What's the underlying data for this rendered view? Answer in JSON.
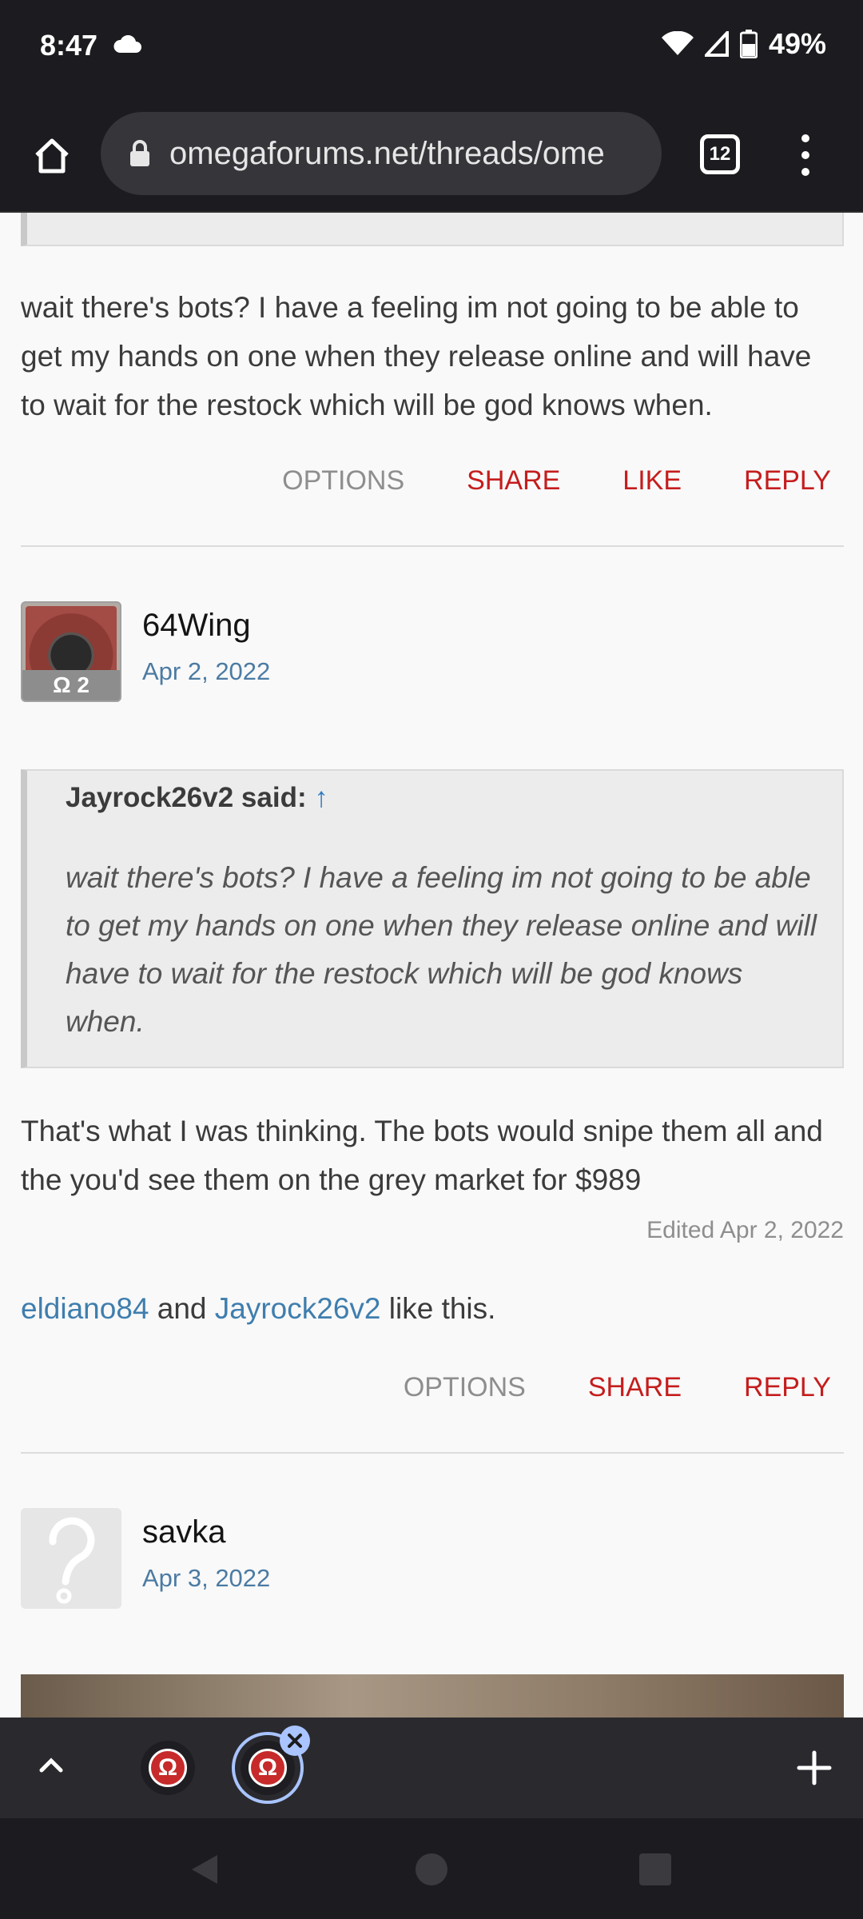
{
  "status_bar": {
    "time": "8:47",
    "battery": "49%",
    "icons": [
      "cloud-icon",
      "wifi-icon",
      "signal-icon",
      "battery-icon"
    ]
  },
  "browser": {
    "url": "omegaforums.net/threads/ome",
    "tab_count": "12"
  },
  "posts": [
    {
      "text": "wait there's bots? I have a feeling im not going to be able to get my hands on one when they release online and will have to wait for the restock which will be god knows when.",
      "actions": {
        "options": "OPTIONS",
        "share": "SHARE",
        "like": "LIKE",
        "reply": "REPLY"
      }
    },
    {
      "username": "64Wing",
      "date": "Apr 2, 2022",
      "badge": "Ω 2",
      "quote": {
        "author": "Jayrock26v2 said:",
        "arrow": "↑",
        "text": "wait there's bots? I have a feeling im not going to be able to get my hands on one when they release online and will have to wait for the restock which will be god knows when."
      },
      "text": "That's what I was thinking. The bots would snipe them all and the you'd see them on the grey market for $989",
      "edited": "Edited Apr 2, 2022",
      "likes": {
        "user1": "eldiano84",
        "and": "and",
        "user2": "Jayrock26v2",
        "suffix": "like this."
      },
      "actions": {
        "options": "OPTIONS",
        "share": "SHARE",
        "reply": "REPLY"
      }
    },
    {
      "username": "savka",
      "date": "Apr 3, 2022"
    }
  ],
  "tab_strip": {
    "favicon_letter": "Ω"
  }
}
